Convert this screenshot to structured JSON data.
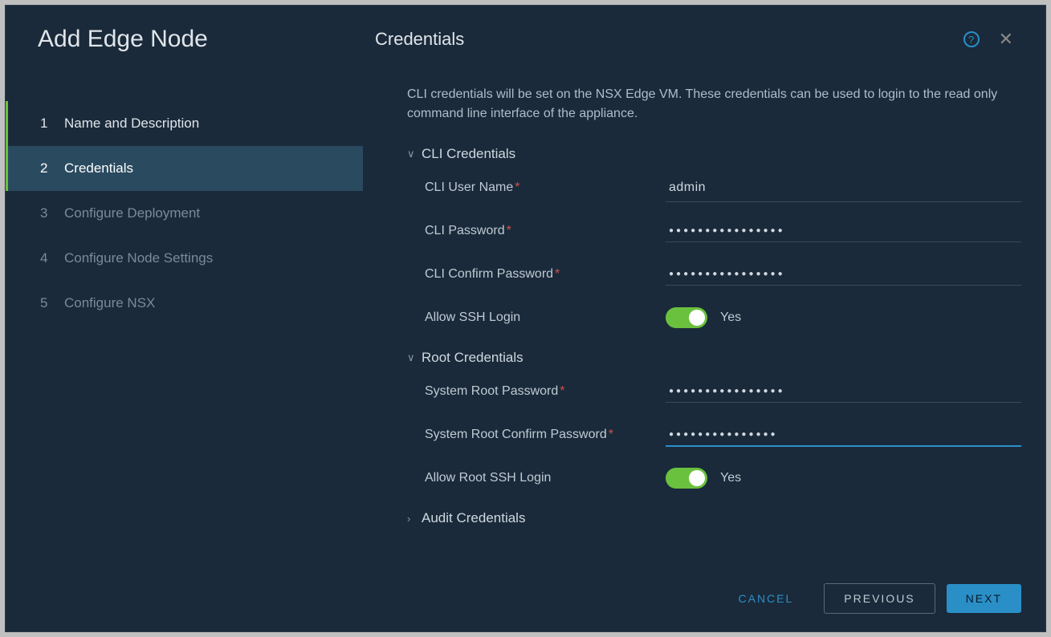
{
  "dialog": {
    "title": "Add Edge Node",
    "panel_title": "Credentials"
  },
  "steps": [
    {
      "num": "1",
      "label": "Name and Description"
    },
    {
      "num": "2",
      "label": "Credentials"
    },
    {
      "num": "3",
      "label": "Configure Deployment"
    },
    {
      "num": "4",
      "label": "Configure Node Settings"
    },
    {
      "num": "5",
      "label": "Configure NSX"
    }
  ],
  "description": "CLI credentials will be set on the NSX Edge VM. These credentials can be used to login to the read only command line interface of the appliance.",
  "sections": {
    "cli_header": "CLI Credentials",
    "root_header": "Root Credentials",
    "audit_header": "Audit Credentials"
  },
  "fields": {
    "cli_user_label": "CLI User Name",
    "cli_user_value": "admin",
    "cli_pw_label": "CLI Password",
    "cli_pw_value": "●●●●●●●●●●●●●●●●",
    "cli_pw_confirm_label": "CLI Confirm Password",
    "cli_pw_confirm_value": "●●●●●●●●●●●●●●●●",
    "ssh_label": "Allow SSH Login",
    "ssh_value": "Yes",
    "root_pw_label": "System Root Password",
    "root_pw_value": "●●●●●●●●●●●●●●●●",
    "root_pw_confirm_label": "System Root Confirm Password",
    "root_pw_confirm_value": "●●●●●●●●●●●●●●●",
    "root_ssh_label": "Allow Root SSH Login",
    "root_ssh_value": "Yes"
  },
  "buttons": {
    "cancel": "CANCEL",
    "previous": "PREVIOUS",
    "next": "NEXT"
  },
  "help_glyph": "?"
}
